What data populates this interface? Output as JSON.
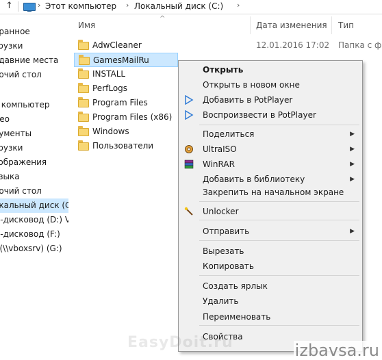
{
  "address_bar": {
    "crumbs": [
      "Этот компьютер",
      "Локальный диск (C:)"
    ],
    "crumb_sep": "›"
  },
  "nav": {
    "items": [
      {
        "label": "бранное",
        "selected": false
      },
      {
        "label": "грузки",
        "selected": false
      },
      {
        "label": "едавние места",
        "selected": false
      },
      {
        "label": "бочий стол",
        "selected": false
      },
      {
        "label": "т компьютер",
        "selected": false
      },
      {
        "label": "део",
        "selected": false
      },
      {
        "label": "кументы",
        "selected": false
      },
      {
        "label": "грузки",
        "selected": false
      },
      {
        "label": "зображения",
        "selected": false
      },
      {
        "label": "узыка",
        "selected": false
      },
      {
        "label": "бочий стол",
        "selected": false
      },
      {
        "label": "окальный диск (C:",
        "selected": true
      },
      {
        "label": "D-дисковод (D:) Vi",
        "selected": false
      },
      {
        "label": "D-дисковод (F:)",
        "selected": false
      },
      {
        "label": ") (\\\\vboxsrv) (G:)",
        "selected": false
      }
    ]
  },
  "columns": {
    "name": "Имя",
    "date": "Дата изменения",
    "type": "Тип"
  },
  "files": [
    {
      "name": "AdwCleaner",
      "date": "12.01.2016 17:02",
      "type": "Папка с фай",
      "selected": false
    },
    {
      "name": "GamesMailRu",
      "date": "",
      "type": "",
      "selected": true
    },
    {
      "name": "INSTALL",
      "date": "",
      "type": "",
      "selected": false
    },
    {
      "name": "PerfLogs",
      "date": "",
      "type": "",
      "selected": false
    },
    {
      "name": "Program Files",
      "date": "",
      "type": "",
      "selected": false
    },
    {
      "name": "Program Files (x86)",
      "date": "",
      "type": "",
      "selected": false
    },
    {
      "name": "Windows",
      "date": "",
      "type": "",
      "selected": false
    },
    {
      "name": "Пользователи",
      "date": "",
      "type": "",
      "selected": false
    }
  ],
  "context_menu": {
    "groups": [
      [
        {
          "label": "Открыть",
          "bold": true,
          "icon": "",
          "submenu": false
        },
        {
          "label": "Открыть в новом окне",
          "bold": false,
          "icon": "",
          "submenu": false
        },
        {
          "label": "Добавить в PotPlayer",
          "bold": false,
          "icon": "play-triangle-icon",
          "submenu": false
        },
        {
          "label": "Воспроизвести в PotPlayer",
          "bold": false,
          "icon": "play-triangle-icon",
          "submenu": false
        }
      ],
      [
        {
          "label": "Поделиться",
          "bold": false,
          "icon": "",
          "submenu": true
        },
        {
          "label": "UltraISO",
          "bold": false,
          "icon": "ultraiso-disc-icon",
          "submenu": true
        },
        {
          "label": "WinRAR",
          "bold": false,
          "icon": "winrar-books-icon",
          "submenu": true
        },
        {
          "label": "Добавить в библиотеку",
          "bold": false,
          "icon": "",
          "submenu": true
        },
        {
          "label": "Закрепить на начальном экране",
          "bold": false,
          "icon": "",
          "submenu": false
        }
      ],
      [
        {
          "label": "Unlocker",
          "bold": false,
          "icon": "magic-wand-icon",
          "submenu": false
        }
      ],
      [
        {
          "label": "Отправить",
          "bold": false,
          "icon": "",
          "submenu": true
        }
      ],
      [
        {
          "label": "Вырезать",
          "bold": false,
          "icon": "",
          "submenu": false
        },
        {
          "label": "Копировать",
          "bold": false,
          "icon": "",
          "submenu": false
        }
      ],
      [
        {
          "label": "Создать ярлык",
          "bold": false,
          "icon": "",
          "submenu": false
        },
        {
          "label": "Удалить",
          "bold": false,
          "icon": "",
          "submenu": false,
          "highlighted": true
        },
        {
          "label": "Переименовать",
          "bold": false,
          "icon": "",
          "submenu": false
        }
      ],
      [
        {
          "label": "Свойства",
          "bold": false,
          "icon": "",
          "submenu": false
        }
      ]
    ],
    "submenu_glyph": "▶",
    "highlight_color": "#ffff33"
  },
  "watermarks": {
    "overlay": "EasyDoit.ru",
    "site": "izbavsa.ru"
  },
  "colors": {
    "selection": "#cce8ff",
    "folder": "#f8d775",
    "menu_bg": "#f0f0f0",
    "potplayer_blue": "#2f7bd6"
  }
}
